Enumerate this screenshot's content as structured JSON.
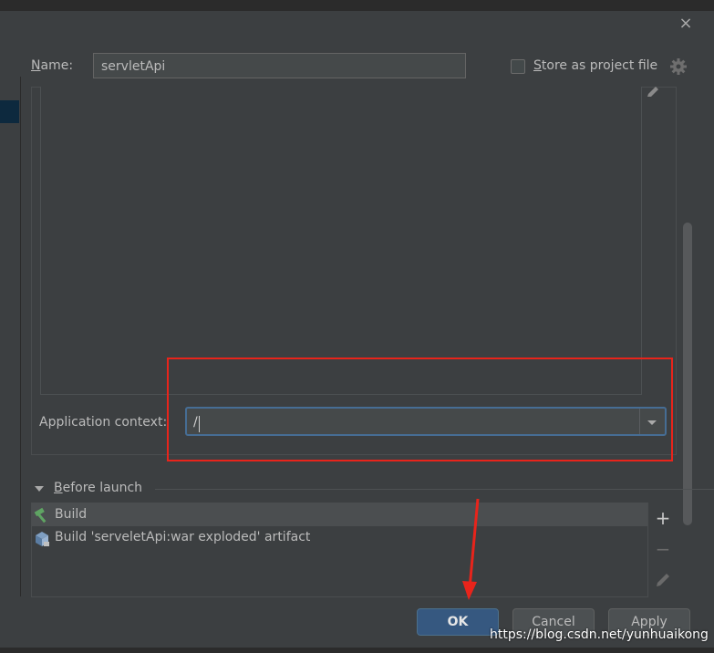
{
  "dialog": {
    "close_glyph": "×",
    "name": {
      "label_u": "N",
      "label_rest": "ame:",
      "value": "servletApi"
    },
    "store": {
      "label_u": "S",
      "label_rest": "tore as project file",
      "checked": false
    },
    "application_context": {
      "label": "Application context:",
      "value": "/"
    },
    "before_launch": {
      "title_u": "B",
      "title_rest": "efore launch",
      "tasks": [
        {
          "icon": "hammer-icon",
          "label": "Build"
        },
        {
          "icon": "artifact-icon",
          "label": "Build 'serveletApi:war exploded' artifact"
        }
      ],
      "tools": {
        "add": "+",
        "remove": "−"
      }
    },
    "buttons": {
      "ok": "OK",
      "cancel": "Cancel",
      "apply": "Apply"
    }
  },
  "watermark": "https://blog.csdn.net/yunhuaikong",
  "colors": {
    "accent": "#365880",
    "highlight": "#e8241b",
    "background": "#3c3f41"
  }
}
